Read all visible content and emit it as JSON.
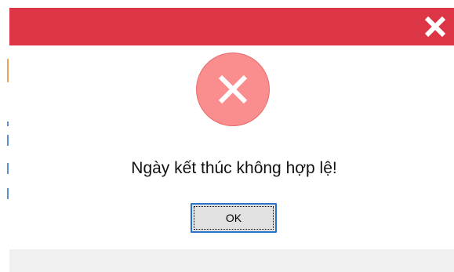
{
  "dialog": {
    "icon": "error-x-icon",
    "message": "Ngày kết thúc không hợp lệ!",
    "ok_label": "OK",
    "close_icon": "close-icon"
  },
  "colors": {
    "titlebar": "#dc3545",
    "error_circle": "#fa8e8e",
    "button_border": "#2b74c7",
    "footer": "#f0f0f0"
  }
}
